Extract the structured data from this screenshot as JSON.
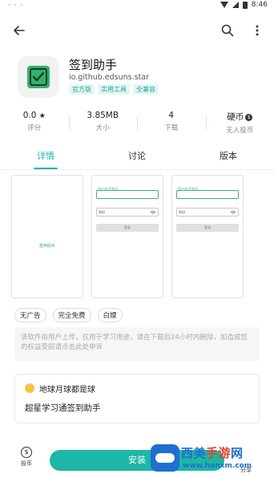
{
  "status_bar": {
    "left": "· · ·",
    "time": "8:46"
  },
  "app": {
    "name": "签到助手",
    "package": "io.github.edsuns.star",
    "tags": [
      "官方版",
      "实用工具",
      "全兼容"
    ]
  },
  "stats": [
    {
      "value": "0.0",
      "value_suffix": "★",
      "label": "评分"
    },
    {
      "value": "3.85MB",
      "value_suffix": "",
      "label": "大小"
    },
    {
      "value": "4",
      "value_suffix": "",
      "label": "下载"
    },
    {
      "value": "硬币",
      "value_suffix": "$",
      "label": "无人投币"
    }
  ],
  "tabs": [
    {
      "label": "详情",
      "active": true
    },
    {
      "label": "讨论",
      "active": false
    },
    {
      "label": "版本",
      "active": false
    }
  ],
  "screenshots": {
    "first_caption": "签到助手",
    "field_label": "用户名/手机号",
    "password_label": "密码",
    "button_label": "登录"
  },
  "chips": [
    "无广告",
    "完全免费",
    "白嫖"
  ],
  "notice": "该软件由用户上传，仅用于学习用途，请在下载后24小时内删除，如造成您的权益受损请点击此处申诉",
  "review": {
    "user": "地球月球都是球",
    "text": "超星学习通签到助手"
  },
  "bottom": {
    "tip_label": "投币",
    "install_label": "安装",
    "share_label": "分享"
  },
  "watermark": {
    "title_a": "西美",
    "title_b": "手游",
    "title_c": "网",
    "url": "www.hanxm.com"
  },
  "colors": {
    "accent": "#1db6a7",
    "icon_green": "#2fb36a"
  },
  "icons": {
    "back": "arrow-left-icon",
    "search": "search-icon",
    "more": "more-vertical-icon"
  }
}
